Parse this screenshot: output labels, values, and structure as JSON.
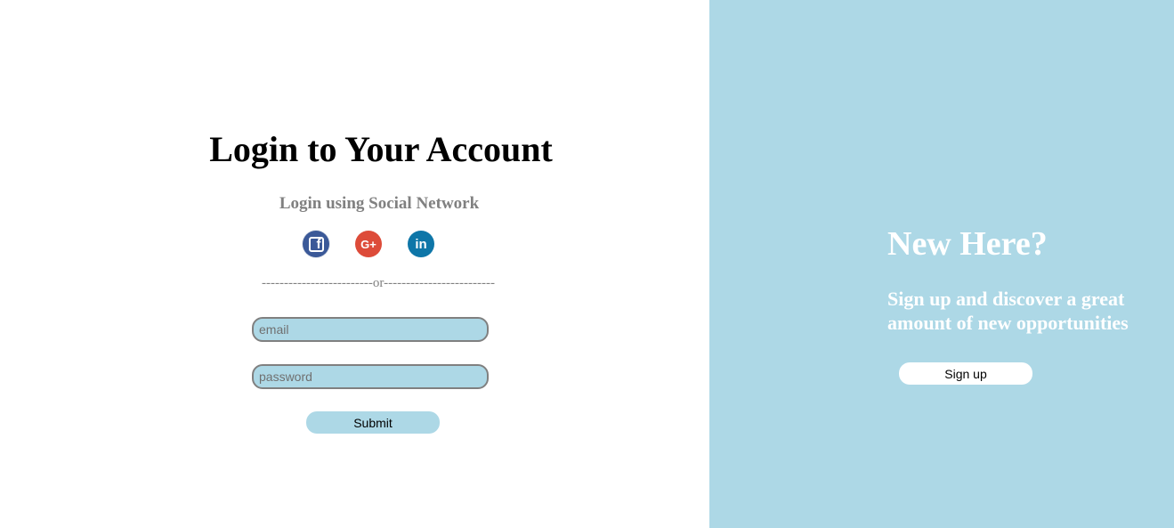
{
  "colors": {
    "accent": "#add8e6",
    "background": "#ffffff",
    "heading_text": "#000000",
    "muted_text": "#808080",
    "facebook": "#3b5998",
    "google_plus": "#dd4b39",
    "linkedin": "#0e76a8"
  },
  "login": {
    "title": "Login to Your Account",
    "social_heading": "Login using Social Network",
    "social_icons": [
      {
        "name": "facebook-icon",
        "glyph": "f"
      },
      {
        "name": "google-plus-icon",
        "glyph": "G+"
      },
      {
        "name": "linkedin-icon",
        "glyph": "in"
      }
    ],
    "divider": "-------------------------or-------------------------",
    "email": {
      "placeholder": "email",
      "value": ""
    },
    "password": {
      "placeholder": "password",
      "value": ""
    },
    "submit_label": "Submit"
  },
  "signup_panel": {
    "title": "New Here?",
    "text": "Sign up and discover a great amount of new opportunities",
    "button_label": "Sign up"
  }
}
